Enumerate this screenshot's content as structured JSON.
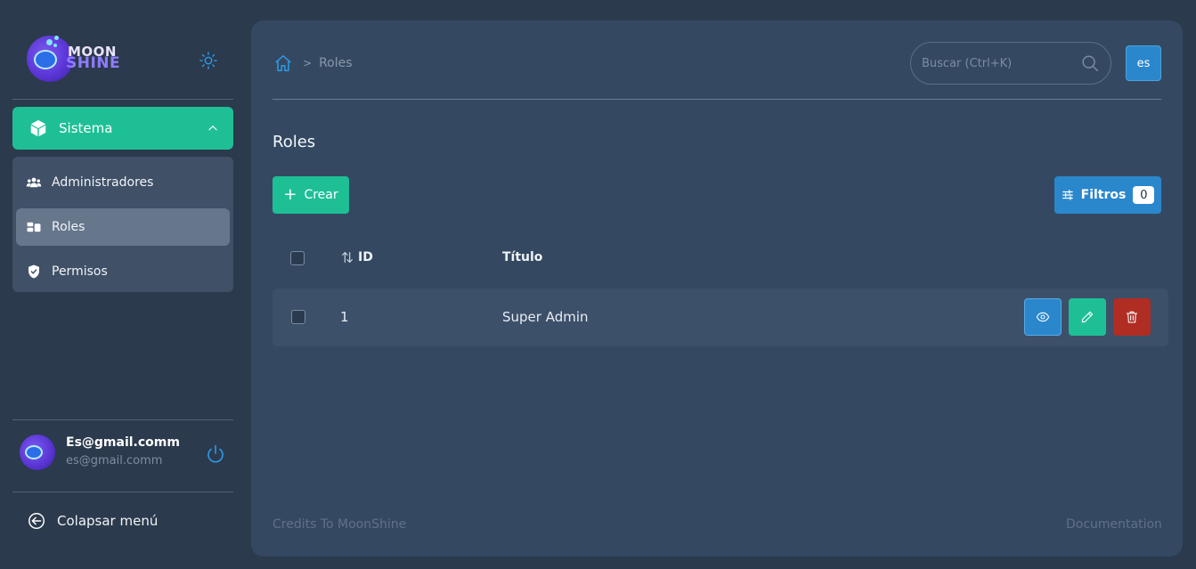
{
  "brand": {
    "line1": "MOON",
    "line2": "SHINE"
  },
  "sidebar": {
    "group_label": "Sistema",
    "items": [
      {
        "label": "Administradores",
        "icon": "users-icon"
      },
      {
        "label": "Roles",
        "icon": "roles-icon",
        "active": true
      },
      {
        "label": "Permisos",
        "icon": "shield-check-icon"
      }
    ],
    "user": {
      "name": "Es@gmail.comm",
      "email": "es@gmail.comm"
    },
    "collapse_label": "Colapsar menú"
  },
  "header": {
    "breadcrumb_current": "Roles",
    "search_placeholder": "Buscar (Ctrl+K)",
    "lang": "es"
  },
  "main": {
    "title": "Roles",
    "create_label": "Crear",
    "filter_label": "Filtros",
    "filter_count": "0",
    "table": {
      "headers": {
        "id": "ID",
        "title": "Título"
      },
      "rows": [
        {
          "id": "1",
          "title": "Super Admin"
        }
      ]
    }
  },
  "footer": {
    "credits": "Credits To MoonShine",
    "docs": "Documentation"
  },
  "colors": {
    "accent_green": "#1fbf96",
    "accent_blue": "#2b87cc",
    "danger": "#b02d24",
    "bg": "#2b3a4c",
    "panel": "#344961"
  }
}
